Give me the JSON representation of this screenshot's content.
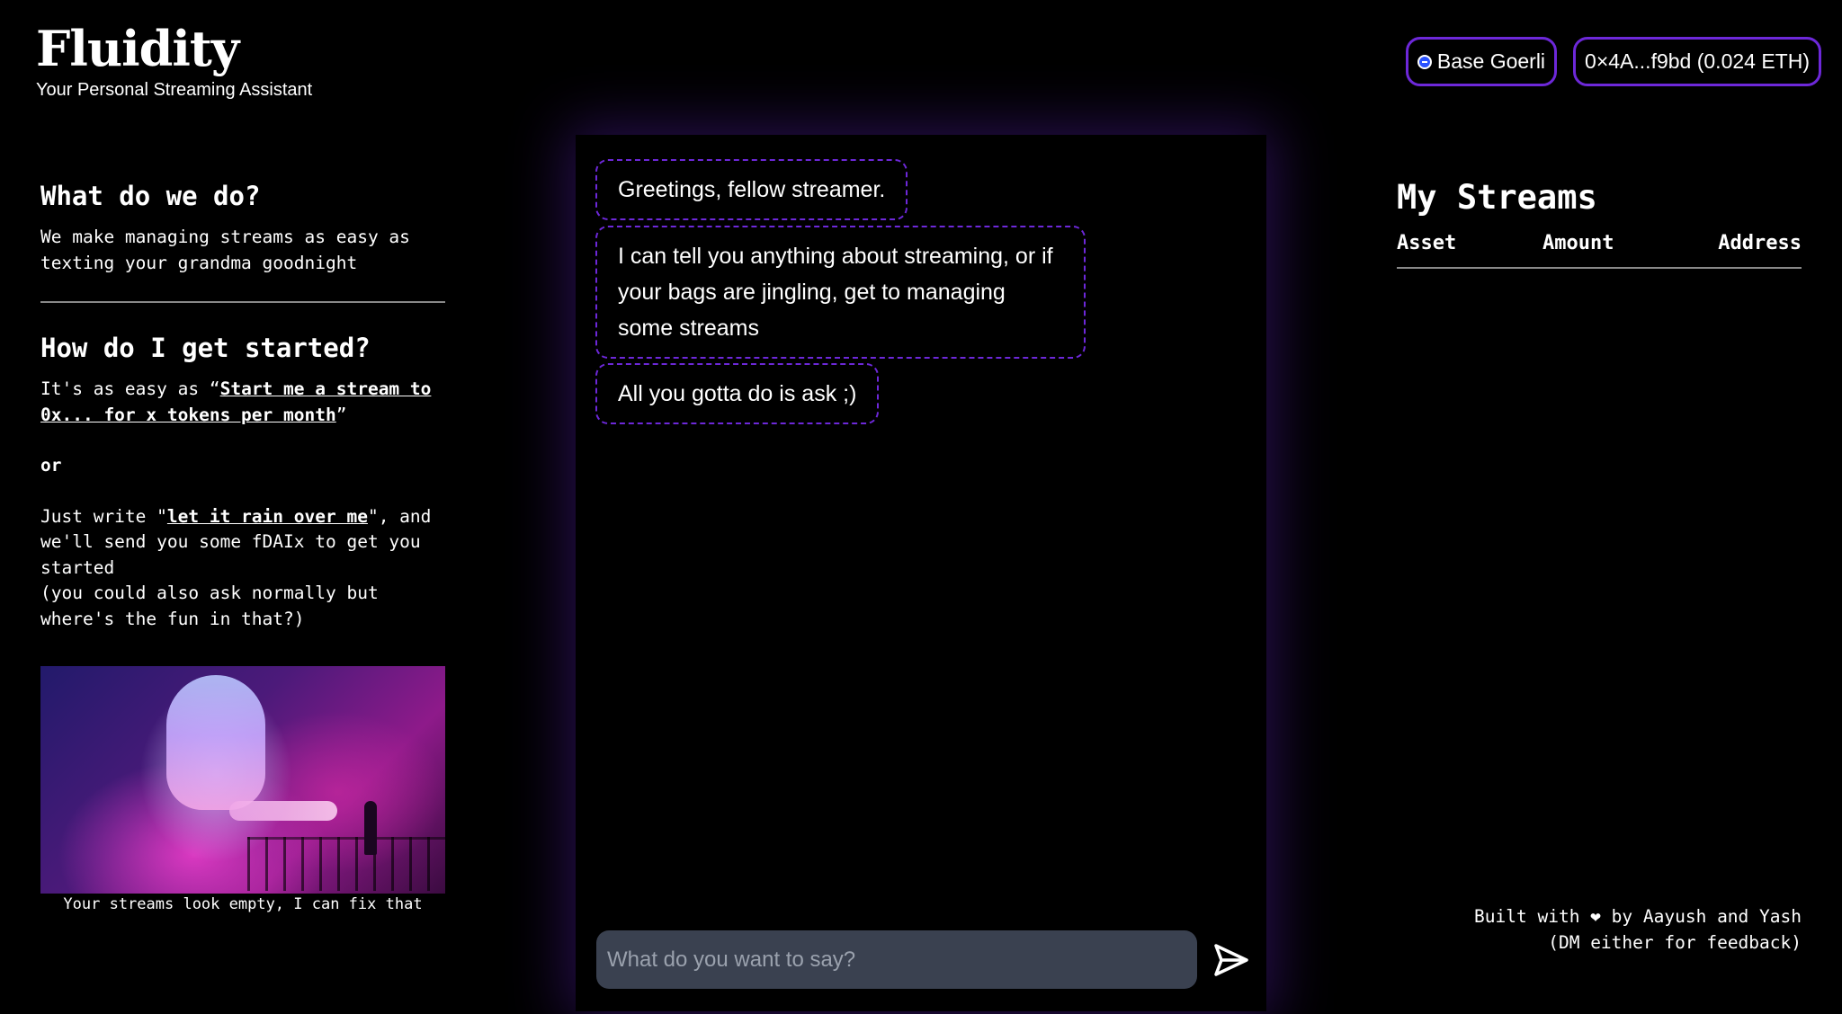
{
  "header": {
    "title": "Fluidity",
    "tagline": "Your Personal Streaming Assistant",
    "network": {
      "label": "Base Goerli",
      "icon": "base-network-icon",
      "color": "#2952ff"
    },
    "wallet": {
      "label": "0×4A...f9bd (0.024 ETH)"
    },
    "accent": "#6d28d9"
  },
  "left": {
    "section1": {
      "heading": "What do we do?",
      "text": "We make managing streams as easy as texting your grandma goodnight"
    },
    "section2": {
      "heading": "How do I get started?",
      "line1_prefix": "It's as easy as “",
      "line1_link": "Start me a stream to 0x... for x tokens per month",
      "line1_suffix": "”",
      "or": "or",
      "line2_prefix": "Just write \"",
      "line2_link": "let it rain over me",
      "line2_suffix": "\", and we'll send you some fDAIx to get you started",
      "line3": "(you could also ask normally but where's the fun in that?)"
    },
    "image_caption": "Your streams look empty, I can fix that"
  },
  "chat": {
    "messages": [
      "Greetings, fellow streamer.",
      "I can tell you anything about streaming, or if your bags are jingling, get to managing some streams",
      "All you gotta do is ask ;)"
    ],
    "input": {
      "value": "",
      "placeholder": "What do you want to say?"
    },
    "send_icon": "send-icon"
  },
  "streams": {
    "heading": "My Streams",
    "columns": [
      "Asset",
      "Amount",
      "Address"
    ],
    "rows": []
  },
  "footer": {
    "line1": "Built with ❤ by Aayush and Yash",
    "line2": "(DM either for feedback)"
  }
}
